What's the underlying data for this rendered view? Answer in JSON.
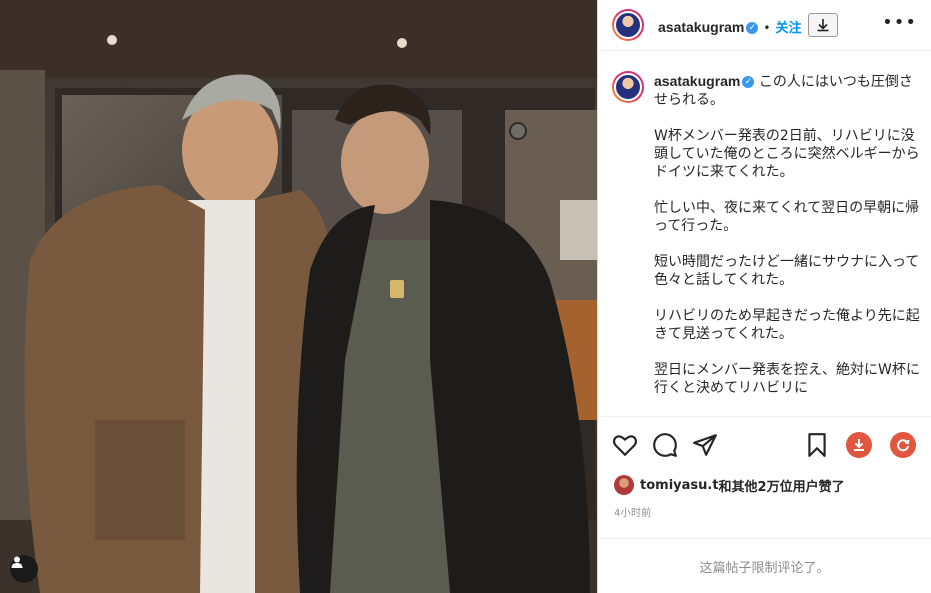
{
  "post": {
    "username": "asatakugram",
    "follow_label": "关注",
    "caption_paragraphs": [
      "この人にはいつも圧倒させられる。",
      "W杯メンバー発表の2日前、リハビリに没頭していた俺のところに突然ベルギーからドイツに来てくれた。",
      "忙しい中、夜に来てくれて翌日の早朝に帰って行った。",
      "短い時間だったけど一緒にサウナに入って色々と話してくれた。",
      "リハビリのため早起きだった俺より先に起きて見送ってくれた。",
      "翌日にメンバー発表を控え、絶対にW杯に行くと決めてリハビリに"
    ],
    "liker_name": "tomiyasu.t",
    "likes_text": "和其他2万位用户赞了",
    "time_ago": "4小时前",
    "comments_restricted": "这篇帖子限制评论了。"
  },
  "colors": {
    "accent_blue": "#0095f6",
    "verified_blue": "#3897f0",
    "download_red": "#e0563f"
  },
  "icons": [
    "tag-user-icon",
    "download-arrow-icon",
    "more-options-icon",
    "heart-icon",
    "comment-icon",
    "share-icon",
    "save-bookmark-icon",
    "download-circle-icon",
    "refresh-circle-icon",
    "verified-badge-icon"
  ]
}
